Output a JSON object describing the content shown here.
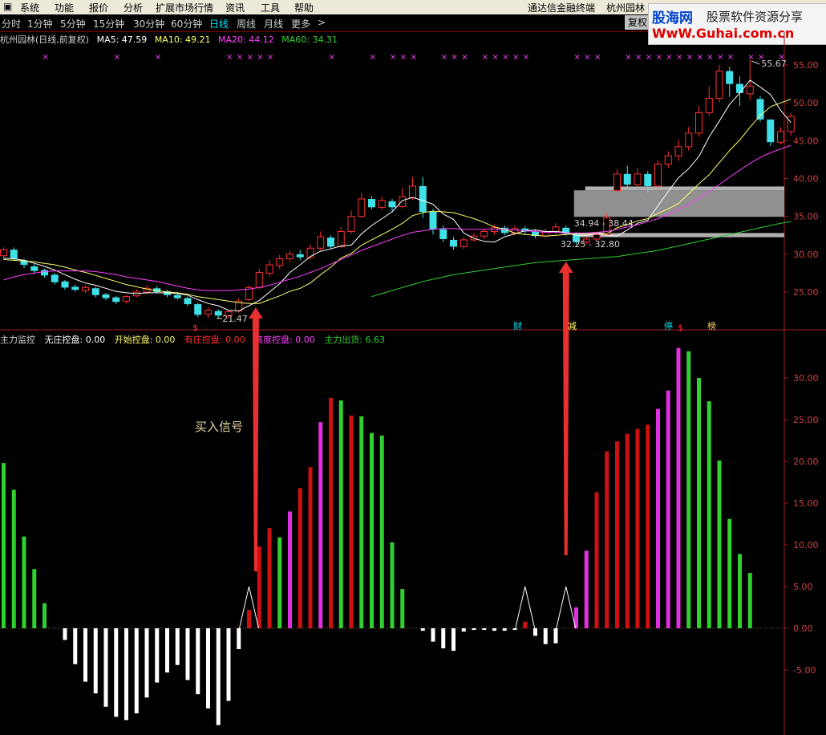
{
  "menu": {
    "items": [
      "系统",
      "功能",
      "报价",
      "分析",
      "扩展市场行情",
      "资讯",
      "工具",
      "帮助"
    ],
    "terminal": "通达信金融终端",
    "stock": "杭州园林"
  },
  "tabs": {
    "items": [
      "分时",
      "1分钟",
      "5分钟",
      "15分钟",
      "30分钟",
      "60分钟",
      "日线",
      "周线",
      "月线",
      "更多"
    ],
    "active_index": 6,
    "more_arrow": ">",
    "fuquan_label": "复权"
  },
  "logo": {
    "line1a": "股海网",
    "line1b": "股票软件资源分享",
    "line2": "WwW.Guhai.com.cn"
  },
  "main_info": {
    "title": "杭州园林(日线,前复权)",
    "ma5": "MA5: 47.59",
    "ma10": "MA10: 49.21",
    "ma20": "MA20: 44.12",
    "ma60": "MA60: 34.31",
    "colors": {
      "ma5": "#ffffff",
      "ma10": "#ffff66",
      "ma20": "#ff40ff",
      "ma60": "#30d030"
    }
  },
  "indicator_info": {
    "title": "主力监控",
    "wuzhuang": "无庄控盘: 0.00",
    "kaishi": "开始控盘: 0.00",
    "youzhuang": "有庄控盘: 0.00",
    "gaodu": "高度控盘: 0.00",
    "chuhuo": "主力出货: 6.63"
  },
  "annotations": {
    "high": "55.67",
    "low": "21.47",
    "zone1": "34.94 - 38.44",
    "zone2": "32.25 - 32.80",
    "buy_signal": "买入信号",
    "markers": [
      "财",
      "减",
      "停",
      "榜"
    ],
    "dollar": "$"
  },
  "chart_data": [
    {
      "type": "candlestick",
      "title": "杭州园林(日线,前复权)",
      "ylim": [
        20,
        57
      ],
      "yticks": [
        "55.00",
        "50.00",
        "45.00",
        "40.00",
        "35.00",
        "30.00",
        "25.00"
      ],
      "candles": [
        [
          29.8,
          30.6,
          30.9,
          29.3
        ],
        [
          30.6,
          29.4,
          30.9,
          29.1
        ],
        [
          29.2,
          28.6,
          29.4,
          28.2
        ],
        [
          28.4,
          27.8,
          28.7,
          27.5
        ],
        [
          27.9,
          27.2,
          28.1,
          26.9
        ],
        [
          27.3,
          26.3,
          27.5,
          26.0
        ],
        [
          26.4,
          25.6,
          26.6,
          25.3
        ],
        [
          25.7,
          25.3,
          26.0,
          25.0
        ],
        [
          25.2,
          25.6,
          25.9,
          24.9
        ],
        [
          25.5,
          24.6,
          25.7,
          24.3
        ],
        [
          24.7,
          24.2,
          24.9,
          23.9
        ],
        [
          24.3,
          23.7,
          24.5,
          23.4
        ],
        [
          23.8,
          24.4,
          24.6,
          23.5
        ],
        [
          24.5,
          25.0,
          25.4,
          24.3
        ],
        [
          25.0,
          25.5,
          25.9,
          24.7
        ],
        [
          25.5,
          25.0,
          25.8,
          24.8
        ],
        [
          25.1,
          24.6,
          25.3,
          24.3
        ],
        [
          24.6,
          24.2,
          24.9,
          24.0
        ],
        [
          24.2,
          23.4,
          24.4,
          23.1
        ],
        [
          23.4,
          22.0,
          23.6,
          21.7
        ],
        [
          22.1,
          22.6,
          22.9,
          21.6
        ],
        [
          22.5,
          21.9,
          22.7,
          21.5
        ],
        [
          21.9,
          22.4,
          22.6,
          21.5
        ],
        [
          22.5,
          23.8,
          24.2,
          22.3
        ],
        [
          24.0,
          25.6,
          25.9,
          23.8
        ],
        [
          25.6,
          27.6,
          28.1,
          25.4
        ],
        [
          27.5,
          28.6,
          29.2,
          27.1
        ],
        [
          28.5,
          29.4,
          29.9,
          28.1
        ],
        [
          29.4,
          30.0,
          30.4,
          29.0
        ],
        [
          30.0,
          29.6,
          30.6,
          29.2
        ],
        [
          29.6,
          30.8,
          31.3,
          29.3
        ],
        [
          30.8,
          32.3,
          33.0,
          30.5
        ],
        [
          32.2,
          31.0,
          32.5,
          30.7
        ],
        [
          31.0,
          33.0,
          33.6,
          30.8
        ],
        [
          33.0,
          35.0,
          35.8,
          32.7
        ],
        [
          35.0,
          37.3,
          38.1,
          34.8
        ],
        [
          37.3,
          36.2,
          37.7,
          35.9
        ],
        [
          36.2,
          37.1,
          37.6,
          35.9
        ],
        [
          37.0,
          36.2,
          37.3,
          35.6
        ],
        [
          36.3,
          37.6,
          38.7,
          36.0
        ],
        [
          37.5,
          39.0,
          40.2,
          37.2
        ],
        [
          39.0,
          35.6,
          40.2,
          34.8
        ],
        [
          35.6,
          33.3,
          36.0,
          32.6
        ],
        [
          33.3,
          32.0,
          33.8,
          31.6
        ],
        [
          31.9,
          31.0,
          32.3,
          30.6
        ],
        [
          31.0,
          31.9,
          32.3,
          30.7
        ],
        [
          31.9,
          32.4,
          32.8,
          31.6
        ],
        [
          32.4,
          33.0,
          33.4,
          32.0
        ],
        [
          33.0,
          33.5,
          33.9,
          32.6
        ],
        [
          33.5,
          32.8,
          33.8,
          32.5
        ],
        [
          32.8,
          33.4,
          33.8,
          32.5
        ],
        [
          33.4,
          33.0,
          33.7,
          32.6
        ],
        [
          33.0,
          32.4,
          33.3,
          32.1
        ],
        [
          32.4,
          33.0,
          33.4,
          32.2
        ],
        [
          33.0,
          33.6,
          34.1,
          32.7
        ],
        [
          33.5,
          32.7,
          33.8,
          32.4
        ],
        [
          32.7,
          31.6,
          32.9,
          31.3
        ],
        [
          31.6,
          32.0,
          32.3,
          31.3
        ],
        [
          32.0,
          32.6,
          33.0,
          31.7
        ],
        [
          32.6,
          34.8,
          35.4,
          32.4
        ],
        [
          38.4,
          40.6,
          41.2,
          38.2
        ],
        [
          40.6,
          39.2,
          41.7,
          38.7
        ],
        [
          39.2,
          40.6,
          41.4,
          38.9
        ],
        [
          40.6,
          39.0,
          41.0,
          38.1
        ],
        [
          39.0,
          41.9,
          42.4,
          38.8
        ],
        [
          41.9,
          43.0,
          43.6,
          41.4
        ],
        [
          43.0,
          44.2,
          45.1,
          42.3
        ],
        [
          44.2,
          46.0,
          46.8,
          43.7
        ],
        [
          46.0,
          48.7,
          49.6,
          45.5
        ],
        [
          48.7,
          50.6,
          52.2,
          48.3
        ],
        [
          50.6,
          54.2,
          55.0,
          50.1
        ],
        [
          54.2,
          52.5,
          54.8,
          50.8
        ],
        [
          52.5,
          51.3,
          53.5,
          49.6
        ],
        [
          51.2,
          52.2,
          55.67,
          50.4
        ],
        [
          50.5,
          47.8,
          50.9,
          47.5
        ],
        [
          47.8,
          44.8,
          47.8,
          44.3
        ],
        [
          44.8,
          46.2,
          46.8,
          44.5
        ],
        [
          46.2,
          48.2,
          48.6,
          45.7
        ]
      ],
      "ma_series": [
        {
          "name": "MA5",
          "values": [
            29.5,
            29.4,
            29.2,
            28.8,
            28.4,
            27.9,
            27.3,
            26.7,
            26.2,
            25.9,
            25.5,
            25.1,
            24.9,
            24.8,
            24.9,
            24.9,
            24.9,
            24.8,
            24.6,
            24.0,
            23.5,
            23.2,
            22.6,
            22.5,
            23.2,
            23.9,
            25.0,
            26.1,
            27.6,
            28.6,
            29.7,
            30.4,
            30.7,
            31.1,
            31.2,
            32.7,
            33.8,
            34.7,
            35.6,
            37.1,
            37.5,
            37.1,
            36.6,
            35.3,
            34.6,
            32.8,
            32.1,
            31.7,
            31.6,
            32.3,
            32.7,
            33.1,
            33.2,
            33.0,
            33.0,
            32.9,
            32.5,
            32.5,
            32.7,
            32.5,
            32.4,
            33.2,
            34.1,
            34.5,
            36.4,
            38.3,
            40.1,
            41.3,
            42.9,
            45.5,
            47.6,
            49.8,
            51.3,
            53.0,
            52.1,
            51.1,
            49.0,
            47.4
          ]
        },
        {
          "name": "MA10",
          "values": [
            29.3,
            29.2,
            29.1,
            29.0,
            28.8,
            28.6,
            28.3,
            27.9,
            27.6,
            27.2,
            26.8,
            26.4,
            26.0,
            25.7,
            25.4,
            25.2,
            25.0,
            24.9,
            24.7,
            24.4,
            24.2,
            24.0,
            23.8,
            23.6,
            23.5,
            23.5,
            24.0,
            24.5,
            25.1,
            25.5,
            26.2,
            27.3,
            28.3,
            29.5,
            30.1,
            31.2,
            31.9,
            32.6,
            33.3,
            34.1,
            35.1,
            35.5,
            35.7,
            35.6,
            35.5,
            35.1,
            34.7,
            34.2,
            33.6,
            33.3,
            32.8,
            32.6,
            32.5,
            32.4,
            32.5,
            32.6,
            32.7,
            32.7,
            32.9,
            32.7,
            33.5,
            33.9,
            34.4,
            34.7,
            35.4,
            36.0,
            36.7,
            38.0,
            39.3,
            40.5,
            42.1,
            43.7,
            45.1,
            46.8,
            48.3,
            49.5,
            50.0,
            50.5
          ]
        },
        {
          "name": "MA20",
          "values": [
            26.6,
            27.0,
            27.3,
            27.5,
            27.7,
            27.8,
            27.8,
            27.8,
            27.8,
            27.7,
            27.5,
            27.3,
            27.0,
            26.8,
            26.6,
            26.4,
            26.1,
            25.8,
            25.5,
            25.3,
            25.2,
            25.2,
            25.2,
            25.3,
            25.4,
            25.6,
            25.9,
            26.3,
            26.7,
            27.1,
            27.6,
            28.1,
            28.7,
            29.3,
            29.9,
            30.5,
            31.0,
            31.5,
            32.0,
            32.5,
            32.9,
            33.1,
            33.3,
            33.4,
            33.4,
            33.3,
            33.3,
            33.3,
            33.3,
            33.3,
            33.2,
            33.1,
            33.0,
            32.9,
            32.9,
            32.8,
            32.8,
            32.8,
            32.9,
            33.0,
            33.3,
            33.6,
            33.9,
            34.3,
            34.7,
            35.3,
            35.9,
            36.6,
            37.4,
            38.3,
            39.2,
            40.2,
            41.1,
            42.0,
            42.8,
            43.4,
            43.9,
            44.4
          ]
        },
        {
          "name": "MA60",
          "values": [
            null,
            null,
            null,
            null,
            null,
            null,
            null,
            null,
            null,
            null,
            null,
            null,
            null,
            null,
            null,
            null,
            null,
            null,
            null,
            null,
            null,
            null,
            null,
            null,
            null,
            null,
            null,
            null,
            null,
            null,
            null,
            null,
            null,
            null,
            null,
            null,
            24.4,
            24.8,
            25.2,
            25.6,
            26.0,
            26.4,
            26.7,
            27.0,
            27.3,
            27.5,
            27.7,
            27.9,
            28.1,
            28.3,
            28.5,
            28.7,
            28.9,
            29.0,
            29.1,
            29.2,
            29.3,
            29.4,
            29.5,
            29.6,
            29.7,
            29.9,
            30.1,
            30.3,
            30.5,
            30.8,
            31.1,
            31.4,
            31.7,
            32.0,
            32.3,
            32.6,
            32.9,
            33.2,
            33.5,
            33.8,
            34.1,
            34.3
          ]
        }
      ]
    },
    {
      "type": "bar",
      "title": "主力监控",
      "ylim": [
        -11,
        35
      ],
      "yticks": [
        "30.00",
        "25.00",
        "20.00",
        "15.00",
        "10.00",
        "5.00",
        "0.00",
        "-5.00"
      ],
      "values": [
        19.8,
        16.6,
        11.0,
        7.1,
        3.0,
        0,
        -1.4,
        -4.3,
        -6.4,
        -7.8,
        -9.4,
        -10.6,
        -11.0,
        -10.2,
        -8.3,
        -6.5,
        -5.3,
        -4.4,
        -6.2,
        -7.9,
        -9.6,
        -11.6,
        -8.7,
        -2.5,
        2.2,
        9.8,
        12.0,
        10.9,
        14.0,
        16.8,
        19.3,
        24.7,
        27.6,
        27.3,
        25.5,
        25.4,
        23.4,
        23.1,
        10.3,
        4.7,
        0,
        -0.3,
        -1.6,
        -2.4,
        -2.7,
        -0.4,
        -0.2,
        -0.2,
        -0.3,
        -0.3,
        -0.2,
        0.8,
        -0.9,
        -1.9,
        -1.8,
        0,
        2.5,
        9.3,
        16.3,
        21.2,
        22.4,
        23.3,
        23.9,
        24.4,
        26.3,
        28.5,
        33.6,
        33.2,
        30.0,
        27.2,
        20.1,
        13.1,
        8.9,
        6.63
      ],
      "colors": [
        "g",
        "g",
        "g",
        "g",
        "g",
        "w",
        "w",
        "w",
        "w",
        "w",
        "w",
        "w",
        "w",
        "w",
        "w",
        "w",
        "w",
        "w",
        "w",
        "w",
        "w",
        "w",
        "w",
        "w",
        "r",
        "r",
        "r",
        "g",
        "m",
        "r",
        "r",
        "m",
        "r",
        "g",
        "r",
        "g",
        "g",
        "g",
        "g",
        "g",
        "w",
        "w",
        "w",
        "w",
        "w",
        "w",
        "w",
        "w",
        "w",
        "w",
        "w",
        "r",
        "w",
        "w",
        "w",
        "w",
        "m",
        "m",
        "r",
        "r",
        "r",
        "r",
        "r",
        "r",
        "m",
        "m",
        "m",
        "g",
        "g",
        "g",
        "g",
        "g",
        "g",
        "g"
      ],
      "palette": {
        "g": "#30d030",
        "r": "#d01010",
        "m": "#e030e0",
        "w": "#ffffff"
      }
    }
  ]
}
